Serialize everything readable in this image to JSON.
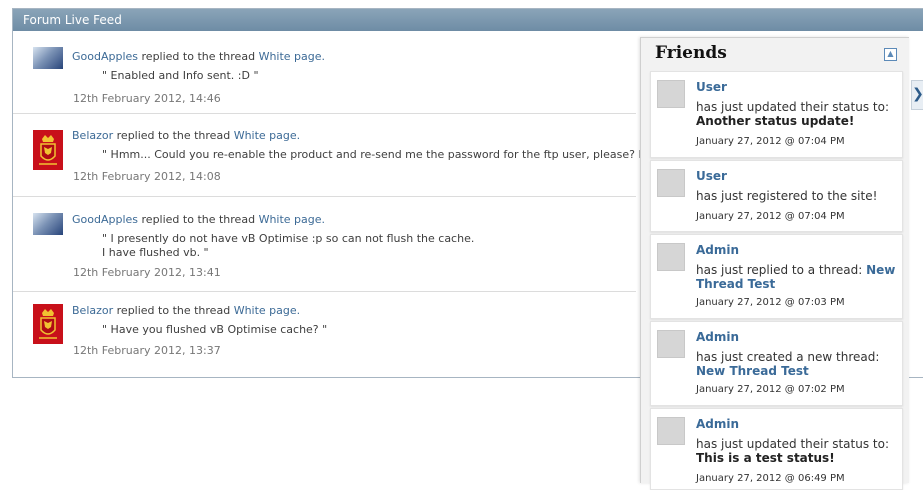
{
  "panel": {
    "title": "Forum Live Feed"
  },
  "feed": [
    {
      "user": "GoodApples",
      "action": "replied to the thread",
      "thread": "White page.",
      "quote": "\" Enabled and Info sent. :D \"",
      "date": "12th February 2012, 14:46",
      "avatar": "goodapples"
    },
    {
      "user": "Belazor",
      "action": "replied to the thread",
      "thread": "White page.",
      "quote": "\" Hmm... Could you re-enable the product and re-send me the password for the ftp user, please? I'll look into it",
      "date": "12th February 2012, 14:08",
      "avatar": "belazor"
    },
    {
      "user": "GoodApples",
      "action": "replied to the thread",
      "thread": "White page.",
      "quote": "\" I presently do not have vB Optimise :p so can not flush the cache.\nI have flushed vb. \"",
      "date": "12th February 2012, 13:41",
      "avatar": "goodapples"
    },
    {
      "user": "Belazor",
      "action": "replied to the thread",
      "thread": "White page.",
      "quote": "\" Have you flushed vB Optimise cache? \"",
      "date": "12th February 2012, 13:37",
      "avatar": "belazor"
    }
  ],
  "friends": {
    "title": "Friends",
    "items": [
      {
        "name": "User",
        "text": "has just updated their status to:",
        "highlight": "Another status update!",
        "date": "January 27, 2012 @ 07:04 PM"
      },
      {
        "name": "User",
        "text": "has just registered to the site!",
        "highlight": "",
        "date": "January 27, 2012 @ 07:04 PM"
      },
      {
        "name": "Admin",
        "text": "has just replied to a thread:",
        "link": "New Thread Test",
        "date": "January 27, 2012 @ 07:03 PM"
      },
      {
        "name": "Admin",
        "text": "has just created a new thread:",
        "link": "New Thread Test",
        "date": "January 27, 2012 @ 07:02 PM"
      },
      {
        "name": "Admin",
        "text": "has just updated their status to:",
        "highlight": "This is a test status!",
        "date": "January 27, 2012 @ 06:49 PM"
      }
    ]
  },
  "icons": {
    "collapse": "collapse-icon",
    "expand_side": "chevron-right-icon"
  }
}
